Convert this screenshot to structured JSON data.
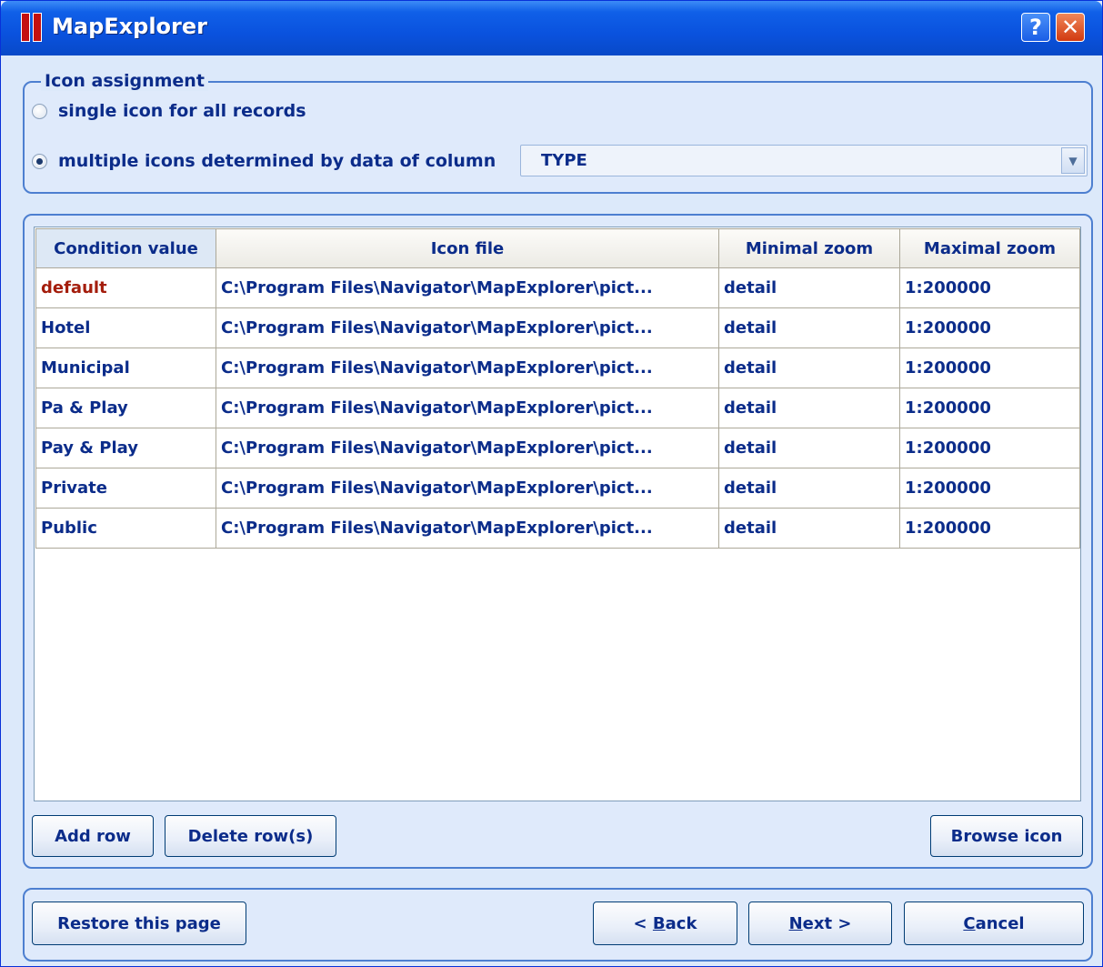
{
  "window": {
    "title": "MapExplorer",
    "help_glyph": "?",
    "close_glyph": "✕"
  },
  "icon_assignment": {
    "legend": "Icon assignment",
    "option_single": "single icon for all records",
    "option_multiple": "multiple icons determined by data of column",
    "selected_option": "multiple",
    "column_value": "TYPE"
  },
  "table": {
    "headers": [
      "Condition value",
      "Icon file",
      "Minimal zoom",
      "Maximal zoom"
    ],
    "rows": [
      {
        "condition": "default",
        "icon_file": "C:\\Program Files\\Navigator\\MapExplorer\\pict...",
        "min_zoom": "detail",
        "max_zoom": "1:200000"
      },
      {
        "condition": "Hotel",
        "icon_file": "C:\\Program Files\\Navigator\\MapExplorer\\pict...",
        "min_zoom": "detail",
        "max_zoom": "1:200000"
      },
      {
        "condition": "Municipal",
        "icon_file": "C:\\Program Files\\Navigator\\MapExplorer\\pict...",
        "min_zoom": "detail",
        "max_zoom": "1:200000"
      },
      {
        "condition": "Pa & Play",
        "icon_file": "C:\\Program Files\\Navigator\\MapExplorer\\pict...",
        "min_zoom": "detail",
        "max_zoom": "1:200000"
      },
      {
        "condition": "Pay & Play",
        "icon_file": "C:\\Program Files\\Navigator\\MapExplorer\\pict...",
        "min_zoom": "detail",
        "max_zoom": "1:200000"
      },
      {
        "condition": "Private",
        "icon_file": "C:\\Program Files\\Navigator\\MapExplorer\\pict...",
        "min_zoom": "detail",
        "max_zoom": "1:200000"
      },
      {
        "condition": "Public",
        "icon_file": "C:\\Program Files\\Navigator\\MapExplorer\\pict...",
        "min_zoom": "detail",
        "max_zoom": "1:200000"
      }
    ]
  },
  "table_buttons": {
    "add_row": "Add row",
    "delete_rows": "Delete row(s)",
    "browse_icon": "Browse icon"
  },
  "footer": {
    "restore": "Restore this page",
    "back_prefix": "< ",
    "back_mnemonic": "B",
    "back_rest": "ack",
    "next_mnemonic": "N",
    "next_rest": "ext >",
    "cancel_mnemonic": "C",
    "cancel_rest": "ancel"
  },
  "colors": {
    "title_bar": "#0a52de",
    "label_text": "#0b2c8a",
    "default_row_text": "#a41d0c",
    "group_border": "#4d7fd0"
  }
}
